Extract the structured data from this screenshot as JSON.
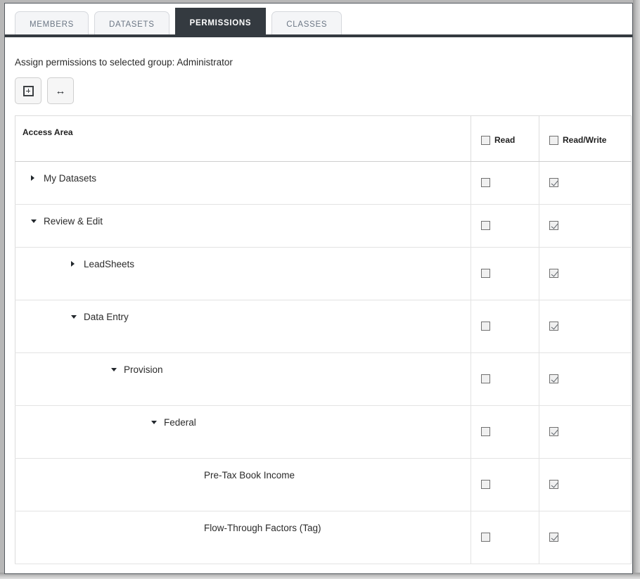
{
  "tabs": [
    {
      "label": "MEMBERS",
      "active": false
    },
    {
      "label": "DATASETS",
      "active": false
    },
    {
      "label": "PERMISSIONS",
      "active": true
    },
    {
      "label": "CLASSES",
      "active": false
    }
  ],
  "assign_text": "Assign permissions to selected group: Administrator",
  "toolbar": {
    "expand_all_title": "Expand All",
    "fit_columns_title": "Fit Columns",
    "fit_columns_glyph": "↔"
  },
  "table": {
    "headers": {
      "access_area": "Access Area",
      "read": "Read",
      "read_write": "Read/Write"
    },
    "header_checks": {
      "read": false,
      "read_write": false
    },
    "rows": [
      {
        "label": "My Datasets",
        "level": 1,
        "toggle": "collapsed",
        "read": false,
        "read_write": true,
        "height": "short"
      },
      {
        "label": "Review & Edit",
        "level": 1,
        "toggle": "expanded",
        "read": false,
        "read_write": true,
        "height": "short"
      },
      {
        "label": "LeadSheets",
        "level": 2,
        "toggle": "collapsed",
        "read": false,
        "read_write": true,
        "height": "tall"
      },
      {
        "label": "Data Entry",
        "level": 2,
        "toggle": "expanded",
        "read": false,
        "read_write": true,
        "height": "tall"
      },
      {
        "label": "Provision",
        "level": 3,
        "toggle": "expanded",
        "read": false,
        "read_write": true,
        "height": "tall"
      },
      {
        "label": "Federal",
        "level": 4,
        "toggle": "expanded",
        "read": false,
        "read_write": true,
        "height": "tall"
      },
      {
        "label": "Pre-Tax Book Income",
        "level": 5,
        "toggle": "none",
        "read": false,
        "read_write": true,
        "height": "tall"
      },
      {
        "label": "Flow-Through Factors (Tag)",
        "level": 5,
        "toggle": "none",
        "read": false,
        "read_write": true,
        "height": "tall"
      }
    ]
  }
}
